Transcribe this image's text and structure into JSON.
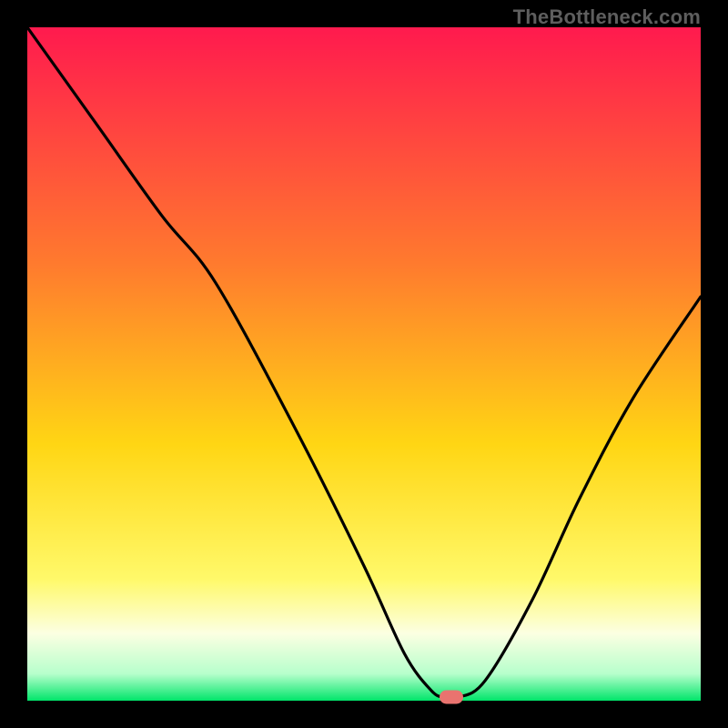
{
  "watermark": "TheBottleneck.com",
  "colors": {
    "top": "#ff1a4e",
    "upper_mid": "#ff7a2e",
    "mid": "#ffd614",
    "lower_mid": "#fff7a0",
    "bottom_band": "#fcffe2",
    "bottom": "#00e56a",
    "marker": "#e9736f",
    "curve": "#000000",
    "frame": "#000000"
  },
  "chart_data": {
    "type": "line",
    "title": "",
    "xlabel": "",
    "ylabel": "",
    "x_range": [
      0,
      100
    ],
    "y_range": [
      0,
      100
    ],
    "series": [
      {
        "name": "bottleneck-curve",
        "x": [
          0,
          10,
          20,
          28,
          40,
          50,
          56,
          60,
          62,
          64,
          68,
          75,
          82,
          90,
          100
        ],
        "values": [
          100,
          86,
          72,
          62,
          40,
          20,
          7,
          1.5,
          0.5,
          0.5,
          3,
          15,
          30,
          45,
          60
        ]
      }
    ],
    "marker": {
      "x": 63,
      "y": 0.5
    },
    "gradient_stops": [
      {
        "pct": 0,
        "color": "#ff1a4e"
      },
      {
        "pct": 35,
        "color": "#ff7a2e"
      },
      {
        "pct": 62,
        "color": "#ffd614"
      },
      {
        "pct": 82,
        "color": "#fff96a"
      },
      {
        "pct": 90,
        "color": "#fcffe2"
      },
      {
        "pct": 96,
        "color": "#b7ffcc"
      },
      {
        "pct": 100,
        "color": "#00e56a"
      }
    ]
  }
}
